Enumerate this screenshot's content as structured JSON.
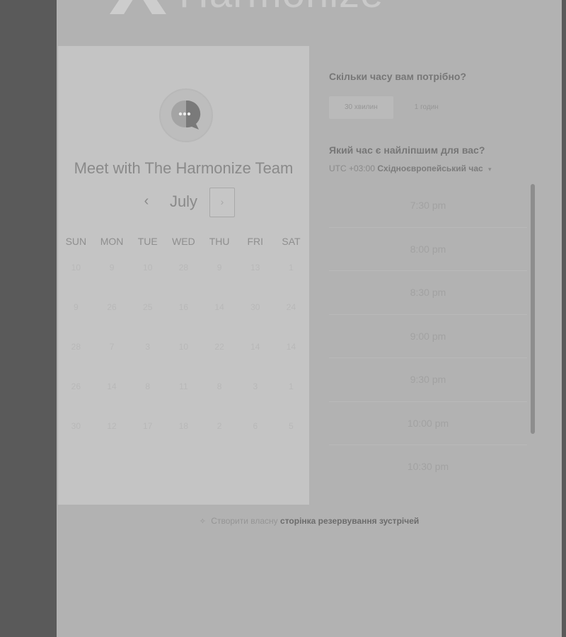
{
  "brand": {
    "name": "Harmonize",
    "logo_icon": "harmonize-logo-icon"
  },
  "calendar": {
    "title": "Meet with The Harmonize Team",
    "avatar_icon": "chat-bubble-icon",
    "month": "July",
    "prev_icon": "chevron-left-icon",
    "next_icon": "chevron-right-icon",
    "prev_glyph": "‹",
    "next_glyph": "›",
    "weekdays": [
      "SUN",
      "MON",
      "TUE",
      "WED",
      "THU",
      "FRI",
      "SAT"
    ],
    "weeks": [
      [
        "10",
        "9",
        "10",
        "28",
        "9",
        "13",
        "1"
      ],
      [
        "9",
        "26",
        "25",
        "16",
        "14",
        "30",
        "24"
      ],
      [
        "28",
        "7",
        "3",
        "10",
        "22",
        "14",
        "14"
      ],
      [
        "26",
        "14",
        "8",
        "11",
        "8",
        "3",
        "1"
      ],
      [
        "30",
        "12",
        "17",
        "18",
        "2",
        "6",
        "5"
      ]
    ]
  },
  "booking": {
    "duration_question": "Скільки часу вам потрібно?",
    "durations": [
      "30 хвилин",
      "1 годин"
    ],
    "time_question": "Який час є найліпшим для вас?",
    "timezone_offset": "UTC +03:00",
    "timezone_name": "Східноєвропейський час",
    "timezone_caret": "▾",
    "slots": [
      "7:30 pm",
      "8:00 pm",
      "8:30 pm",
      "9:00 pm",
      "9:30 pm",
      "10:00 pm",
      "10:30 pm"
    ]
  },
  "footer": {
    "icon": "sparkle-icon",
    "prefix": "Створити власну",
    "link": "сторінка резервування зустрічей"
  },
  "colors": {
    "backdrop": "#5a5a5a",
    "page": "#b2b2b2",
    "card": "#c4c4c4"
  }
}
